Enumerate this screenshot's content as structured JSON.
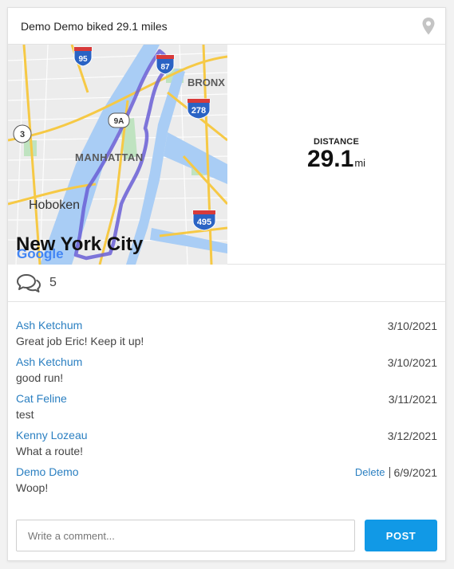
{
  "header": {
    "title": "Demo Demo biked 29.1 miles",
    "icon": "location-pin-icon"
  },
  "map": {
    "labels": {
      "bronx": "BRONX",
      "manhattan": "MANHATTAN",
      "hoboken": "Hoboken",
      "nyc": "New York City",
      "google": "Google"
    },
    "shields": {
      "i95": "95",
      "i87": "87",
      "i278": "278",
      "i495": "495",
      "r9a": "9A",
      "r3": "3"
    },
    "colors": {
      "route": "#6a5fd6",
      "highway": "#f6c945",
      "water": "#a9cdf5",
      "park": "#bfe3c0",
      "land": "#ececec"
    }
  },
  "stat": {
    "label": "DISTANCE",
    "value": "29.1",
    "unit": "mi"
  },
  "comments_bar": {
    "icon": "comments-icon",
    "count": "5"
  },
  "comments": [
    {
      "author": "Ash Ketchum",
      "text": "Great job Eric! Keep it up!",
      "date": "3/10/2021"
    },
    {
      "author": "Ash Ketchum",
      "text": "good run!",
      "date": "3/10/2021"
    },
    {
      "author": "Cat Feline",
      "text": "test",
      "date": "3/11/2021"
    },
    {
      "author": "Kenny Lozeau",
      "text": "What a route!",
      "date": "3/12/2021"
    },
    {
      "author": "Demo Demo",
      "text": "Woop!",
      "date": "6/9/2021",
      "delete_label": "Delete"
    }
  ],
  "composer": {
    "placeholder": "Write a comment...",
    "post_label": "POST"
  },
  "colors": {
    "link": "#2a7fc1",
    "accent": "#1199e6"
  }
}
